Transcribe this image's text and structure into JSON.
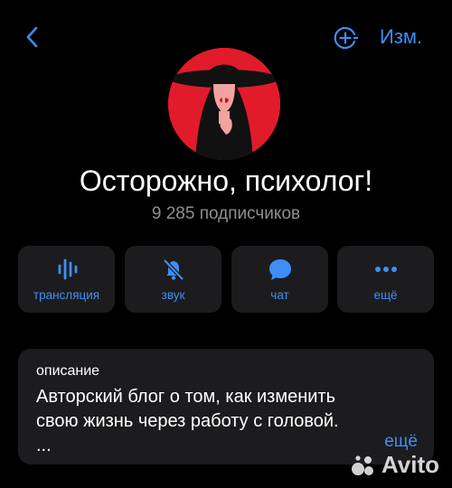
{
  "header": {
    "back_icon": "chevron-left-icon",
    "add_icon": "add-circle-icon",
    "edit_label": "Изм."
  },
  "channel": {
    "title": "Осторожно, психолог!",
    "subscribers": "9 285 подписчиков"
  },
  "actions": [
    {
      "label": "трансляция",
      "icon": "voice-chat-icon"
    },
    {
      "label": "звук",
      "icon": "bell-muted-icon"
    },
    {
      "label": "чат",
      "icon": "chat-bubble-icon"
    },
    {
      "label": "ещё",
      "icon": "more-dots-icon"
    }
  ],
  "description": {
    "label": "описание",
    "line1": "Авторский блог о том, как изменить",
    "line2": "свою жизнь через работу с головой.",
    "line3": "...",
    "more": "ещё"
  },
  "watermark": {
    "text": "Avito"
  },
  "colors": {
    "accent": "#3e8ef7",
    "card_bg": "#1c1c1e",
    "background": "#000000",
    "avatar_red": "#e21b2a"
  }
}
